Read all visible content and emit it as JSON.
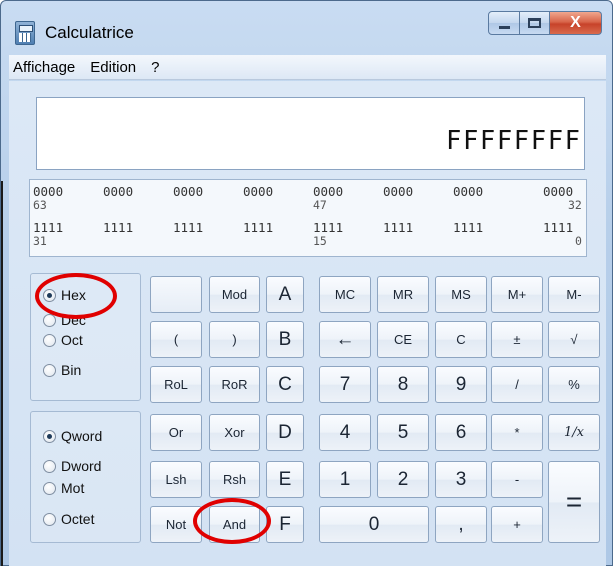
{
  "window": {
    "title": "Calculatrice",
    "close_glyph": "X"
  },
  "menu": [
    "Affichage",
    "Edition",
    "?"
  ],
  "display": {
    "value": "FFFFFFFF"
  },
  "bits": {
    "row1_groups": [
      "0000",
      "0000",
      "0000",
      "0000",
      "0000",
      "0000",
      "0000",
      "0000"
    ],
    "row1_labels": [
      "63",
      "47",
      "32"
    ],
    "row2_groups": [
      "1111",
      "1111",
      "1111",
      "1111",
      "1111",
      "1111",
      "1111",
      "1111"
    ],
    "row2_labels": [
      "31",
      "15",
      "0"
    ]
  },
  "base_radios": [
    {
      "label": "Hex",
      "checked": true
    },
    {
      "label": "Déc",
      "checked": false
    },
    {
      "label": "Oct",
      "checked": false
    },
    {
      "label": "Bin",
      "checked": false
    }
  ],
  "size_radios": [
    {
      "label": "Qword",
      "checked": true
    },
    {
      "label": "Dword",
      "checked": false
    },
    {
      "label": "Mot",
      "checked": false
    },
    {
      "label": "Octet",
      "checked": false
    }
  ],
  "buttons": {
    "r1": [
      "",
      "Mod",
      "A",
      "MC",
      "MR",
      "MS",
      "M+",
      "M-"
    ],
    "r2": [
      "(",
      ")",
      "B",
      "←",
      "CE",
      "C",
      "±",
      "√"
    ],
    "r3": [
      "RoL",
      "RoR",
      "C",
      "7",
      "8",
      "9",
      "/",
      "%"
    ],
    "r4": [
      "Or",
      "Xor",
      "D",
      "4",
      "5",
      "6",
      "*",
      "1/x"
    ],
    "r5": [
      "Lsh",
      "Rsh",
      "E",
      "1",
      "2",
      "3",
      "-",
      "="
    ],
    "r6": [
      "Not",
      "And",
      "F",
      "0",
      ",",
      "+"
    ]
  },
  "highlight_color": "#e00000"
}
